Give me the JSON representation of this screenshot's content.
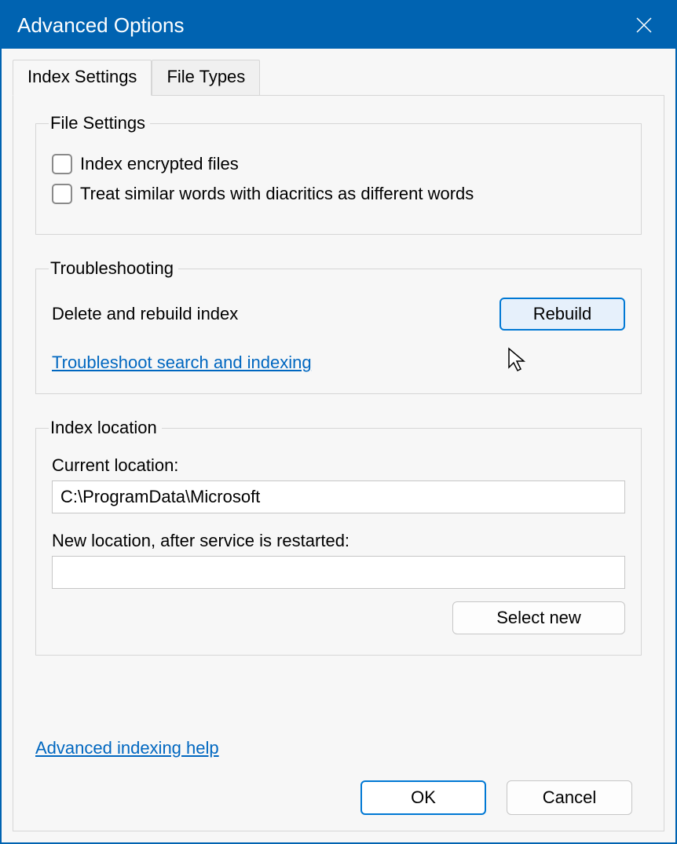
{
  "window": {
    "title": "Advanced Options"
  },
  "tabs": {
    "index_settings": "Index Settings",
    "file_types": "File Types"
  },
  "file_settings": {
    "legend": "File Settings",
    "encrypted_label": "Index encrypted files",
    "encrypted_checked": false,
    "diacritics_label": "Treat similar words with diacritics as different words",
    "diacritics_checked": false
  },
  "troubleshooting": {
    "legend": "Troubleshooting",
    "rebuild_label": "Delete and rebuild index",
    "rebuild_button": "Rebuild",
    "troubleshoot_link": "Troubleshoot search and indexing"
  },
  "index_location": {
    "legend": "Index location",
    "current_label": "Current location:",
    "current_value": "C:\\ProgramData\\Microsoft",
    "new_label": "New location, after service is restarted:",
    "new_value": "",
    "select_new_button": "Select new"
  },
  "help_link": "Advanced indexing help",
  "dialog": {
    "ok": "OK",
    "cancel": "Cancel"
  },
  "colors": {
    "titlebar": "#0063b1",
    "link": "#0067c0",
    "accent": "#0078d4"
  }
}
